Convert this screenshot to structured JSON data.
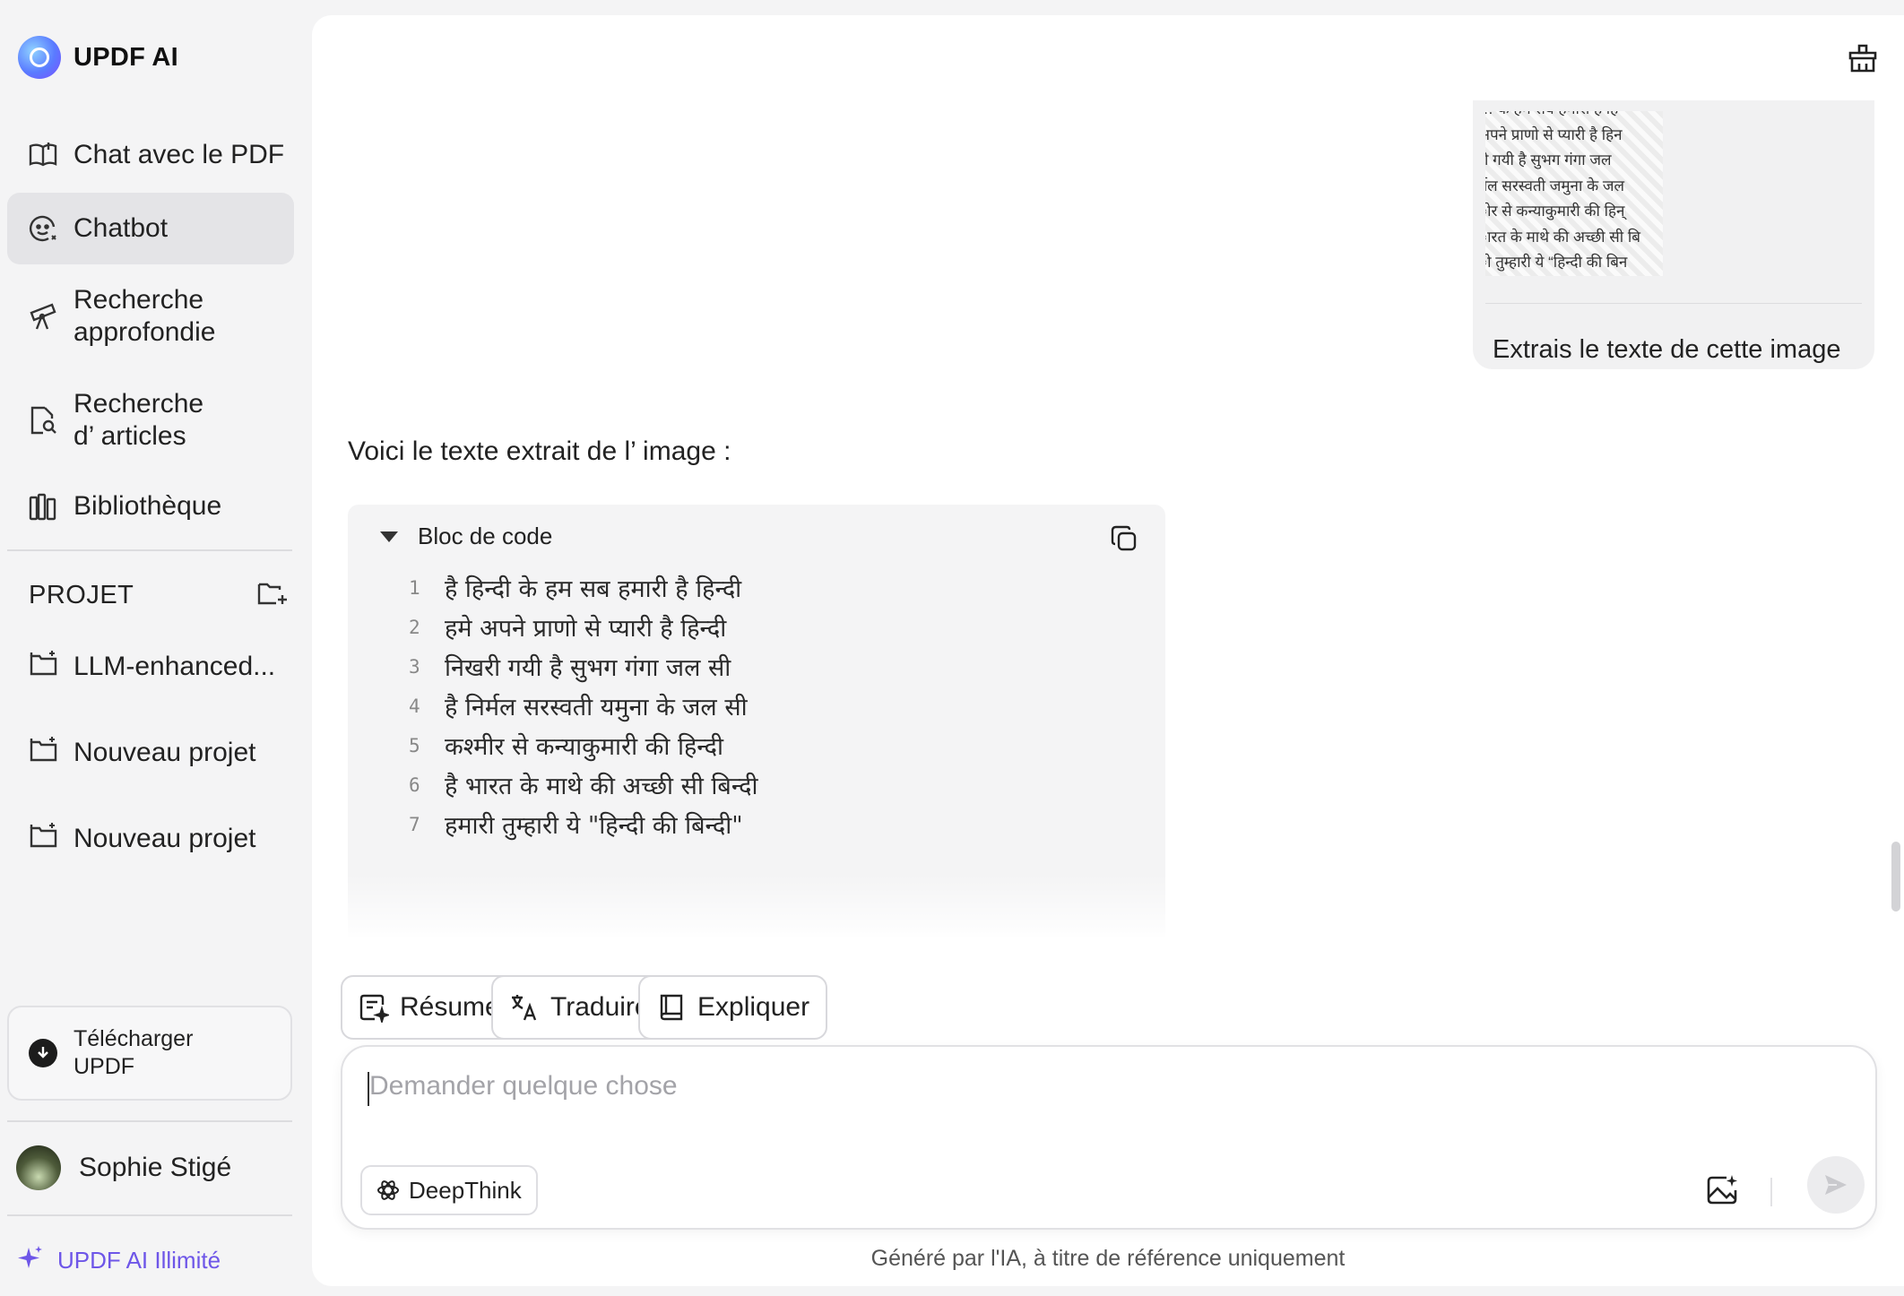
{
  "app": {
    "title": "UPDF AI"
  },
  "sidebar": {
    "items": [
      {
        "label": "Chat avec le PDF",
        "icon": "book-open-icon"
      },
      {
        "label": "Chatbot",
        "icon": "bot-face-icon",
        "active": true
      },
      {
        "label_line1": "Recherche",
        "label_line2": "approfondie",
        "icon": "telescope-icon"
      },
      {
        "label_line1": "Recherche",
        "label_line2": "d’ articles",
        "icon": "search-document-icon"
      },
      {
        "label": "Bibliothèque",
        "icon": "library-icon"
      }
    ],
    "projects_title": "PROJET",
    "projects": [
      "LLM-enhanced...",
      "Nouveau projet",
      "Nouveau projet"
    ],
    "download": {
      "line1": "Télécharger",
      "line2": "UPDF"
    },
    "user": {
      "name": "Sophie Stigé"
    },
    "upgrade": {
      "label": "UPDF AI Illimité"
    }
  },
  "chat": {
    "user_message": {
      "image_lines": [
        "… के हम सब हमारी है हि",
        "अपने प्राणो से प्यारी है हिन",
        "री गयी है सुभग गंगा जल",
        "र्मल सरस्वती जमुना के जल",
        "ोर से कन्याकुमारी की हिन्",
        "ारत के माथे की अच्छी सी बि",
        "ो तुम्हारी ये “हिन्दी की बिन"
      ],
      "text": "Extrais le texte de cette image"
    },
    "reply": {
      "intro": "Voici le texte extrait de l’ image :",
      "code_title": "Bloc de code",
      "lines": [
        {
          "n": "1",
          "text": "है हिन्दी के हम सब हमारी है हिन्दी"
        },
        {
          "n": "2",
          "text": "हमे अपने प्राणो से प्यारी है हिन्दी"
        },
        {
          "n": "3",
          "text": "निखरी गयी है सुभग गंगा जल सी"
        },
        {
          "n": "4",
          "text": "है निर्मल सरस्वती यमुना के जल सी"
        },
        {
          "n": "5",
          "text": "कश्मीर से कन्याकुमारी की हिन्दी"
        },
        {
          "n": "6",
          "text": "है भारत के माथे की अच्छी सी बिन्दी"
        },
        {
          "n": "7",
          "text": "हमारी तुम्हारी ये \"हिन्दी की बिन्दी\""
        }
      ]
    }
  },
  "actions": {
    "summarize": "Résumer",
    "translate": "Traduire",
    "explain": "Expliquer"
  },
  "composer": {
    "placeholder": "Demander quelque chose",
    "deepthink": "DeepThink"
  },
  "footer": {
    "note": "Généré par l'IA, à titre de référence uniquement"
  },
  "colors": {
    "accent": "#6e56e8",
    "active_bg": "#e4e4e7",
    "panel_bg": "#ffffff",
    "app_bg": "#f4f4f5"
  }
}
